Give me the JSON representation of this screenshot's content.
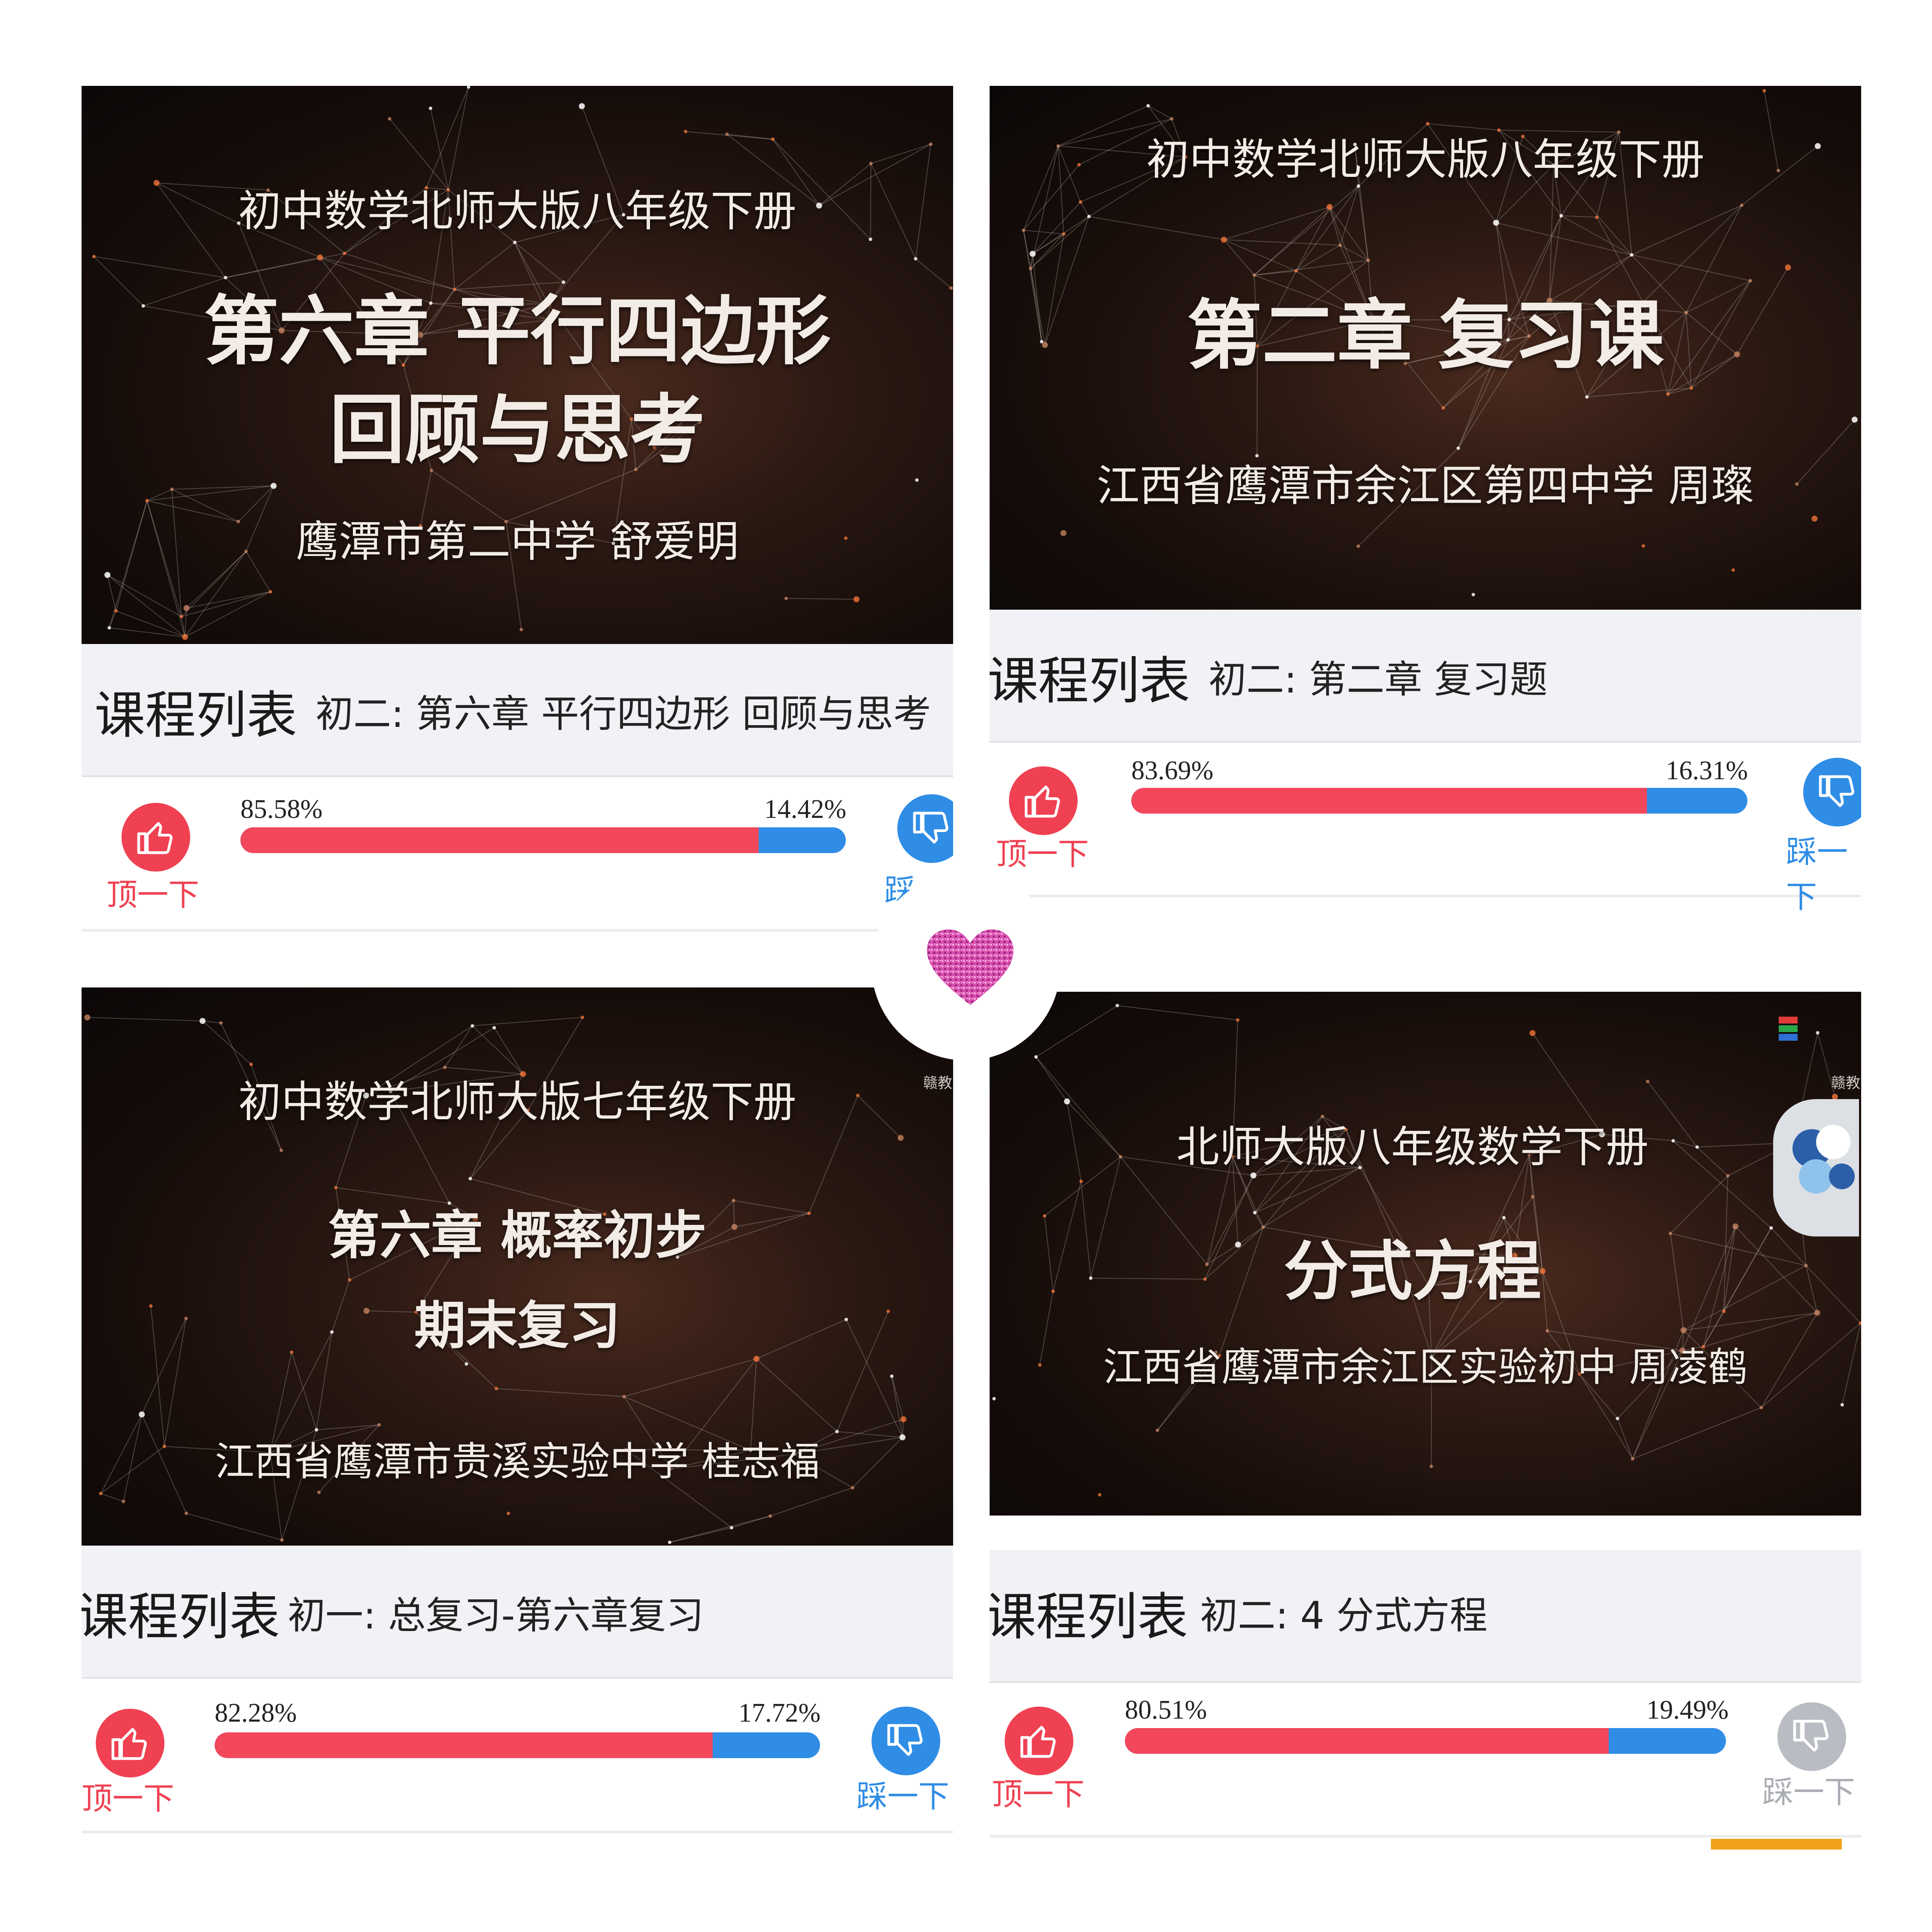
{
  "panels": [
    {
      "video": {
        "subtitle": "初中数学北师大版八年级下册",
        "title_line1": "第六章  平行四边形",
        "title_line2": "回顾与思考",
        "school": "鹰潭市第二中学  舒爱明"
      },
      "list_label": "课程列表",
      "course": "初二: 第六章 平行四边形 回顾与思考",
      "vote": {
        "up_label": "顶一下",
        "down_label": "踩",
        "up_percent_text": "85.58%",
        "down_percent_text": "14.42%",
        "up_fraction": 0.8558
      }
    },
    {
      "video": {
        "subtitle": "初中数学北师大版八年级下册",
        "title_line1": "第二章  复习课",
        "school": "江西省鹰潭市余江区第四中学    周璨"
      },
      "list_label": "课程列表",
      "course": "初二: 第二章 复习题",
      "vote": {
        "up_label": "顶一下",
        "down_label": "踩一下",
        "up_percent_text": "83.69%",
        "down_percent_text": "16.31%",
        "up_fraction": 0.8369
      }
    },
    {
      "video": {
        "subtitle": "初中数学北师大版七年级下册",
        "title_line1": "第六章    概率初步",
        "title_line2": "期末复习",
        "school": "江西省鹰潭市贵溪实验中学    桂志福",
        "watermark": "赣教"
      },
      "list_label": "课程列表",
      "course": "初一: 总复习-第六章复习",
      "vote": {
        "up_label": "顶一下",
        "down_label": "踩一下",
        "up_percent_text": "82.28%",
        "down_percent_text": "17.72%",
        "up_fraction": 0.8228
      }
    },
    {
      "video": {
        "subtitle": "北师大版八年级数学下册",
        "title_line1": "分式方程",
        "school": "江西省鹰潭市余江区实验初中    周凌鹤",
        "watermark": "赣教"
      },
      "list_label": "课程列表",
      "course": "初二: 4 分式方程",
      "vote": {
        "up_label": "顶一下",
        "down_label": "踩一下",
        "up_percent_text": "80.51%",
        "down_percent_text": "19.49%",
        "up_fraction": 0.8051
      }
    }
  ],
  "colors": {
    "up": "#ef4152",
    "down": "#2f8de6",
    "down_disabled": "#b9bcc3",
    "heart": "#d94fb0"
  },
  "icons": {
    "up": "thumbs-up-icon",
    "down": "thumbs-down-icon",
    "center": "heart-icon"
  }
}
